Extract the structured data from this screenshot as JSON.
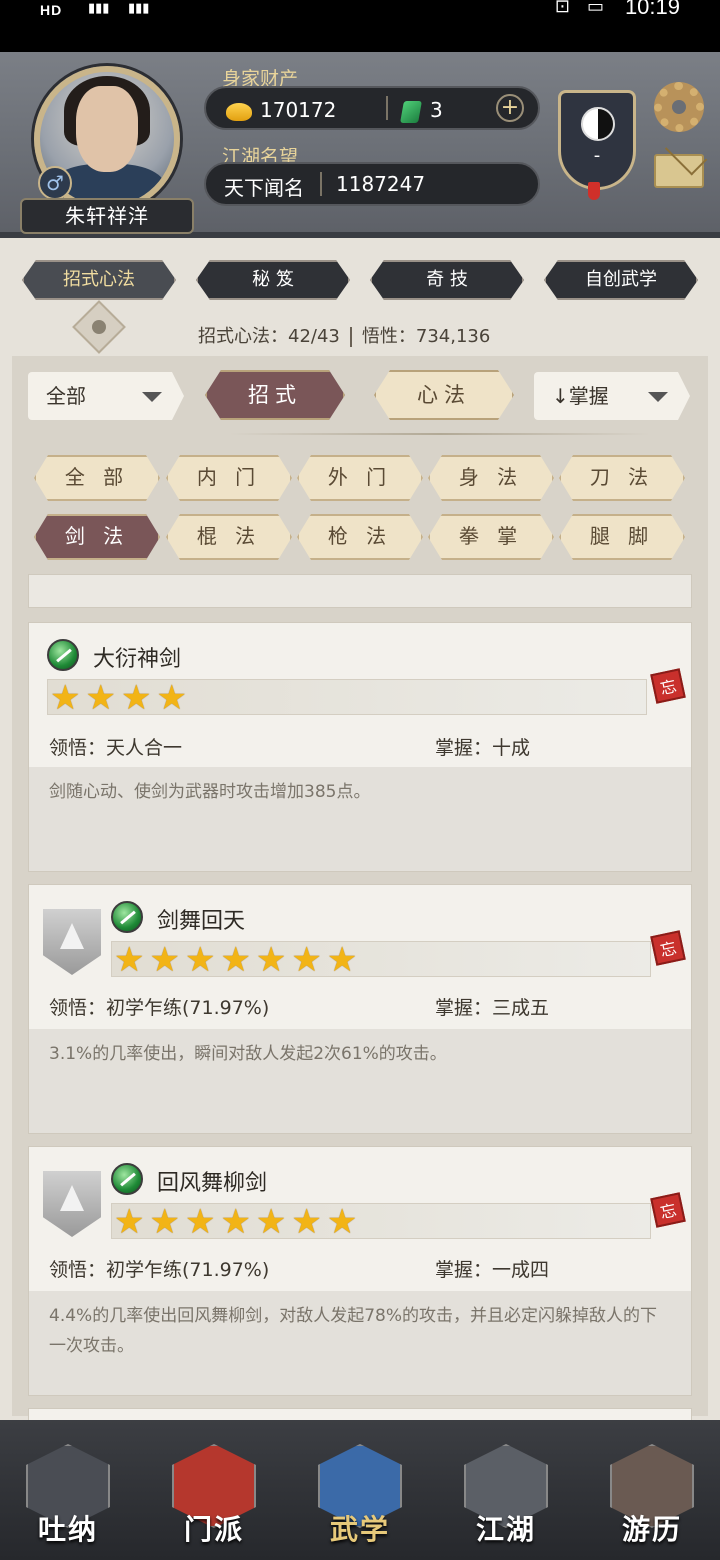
{
  "status_bar": {
    "left_text": "HD",
    "time": "10:19"
  },
  "header": {
    "player_name": "朱轩祥洋",
    "gender_symbol": "♂",
    "wealth_label": "身家财产",
    "gold": "170172",
    "jade": "3",
    "add_symbol": "+",
    "reputation_label": "江湖名望",
    "reputation_title": "天下闻名",
    "reputation_value": "1187247",
    "emblem_text": "-"
  },
  "top_tabs": [
    {
      "label": "招式心法"
    },
    {
      "label": "秘 笈"
    },
    {
      "label": "奇 技"
    },
    {
      "label": "自创武学"
    }
  ],
  "stats": {
    "moves": "招式心法：42/43",
    "insight": "悟性：734,136"
  },
  "filters": {
    "scope": "全部",
    "type_moves": "招式",
    "type_mind": "心法",
    "sort": "↓掌握"
  },
  "categories": [
    "全 部",
    "内 门",
    "外 门",
    "身 法",
    "刀 法",
    "剑 法",
    "棍 法",
    "枪 法",
    "拳 掌",
    "腿 脚"
  ],
  "skills": [
    {
      "name": "大衍神剑",
      "stars": "★★★★",
      "insight": "领悟：天人合一",
      "mastery": "掌握：十成",
      "desc": "剑随心动、使剑为武器时攻击增加385点。",
      "seal": "忘"
    },
    {
      "name": "剑舞回天",
      "stars": "★★★★★★★",
      "insight": "领悟：初学乍练(71.97%)",
      "mastery": "掌握：三成五",
      "desc": "3.1%的几率使出，瞬间对敌人发起2次61%的攻击。",
      "seal": "忘"
    },
    {
      "name": "回风舞柳剑",
      "stars": "★★★★★★★",
      "insight": "领悟：初学乍练(71.97%)",
      "mastery": "掌握：一成四",
      "desc": "4.4%的几率使出回风舞柳剑，对敌人发起78%的攻击，并且必定闪躲掉敌人的下一次攻击。",
      "seal": "忘"
    }
  ],
  "bottom_nav": [
    {
      "label": "吐纳"
    },
    {
      "label": "门派"
    },
    {
      "label": "武学"
    },
    {
      "label": "江湖"
    },
    {
      "label": "游历"
    }
  ]
}
